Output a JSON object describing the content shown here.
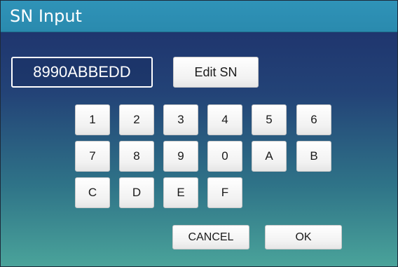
{
  "window": {
    "title": "SN Input"
  },
  "sn": {
    "value": "8990ABBEDD",
    "edit_label": "Edit SN"
  },
  "keypad": {
    "rows": [
      [
        "1",
        "2",
        "3",
        "4",
        "5",
        "6"
      ],
      [
        "7",
        "8",
        "9",
        "0",
        "A",
        "B"
      ],
      [
        "C",
        "D",
        "E",
        "F"
      ]
    ]
  },
  "actions": {
    "cancel_label": "CANCEL",
    "ok_label": "OK"
  },
  "colors": {
    "titlebar": "#2f93b8",
    "background_top": "#1d2f6a",
    "background_bottom": "#4aa39a",
    "button_face": "#f2f2f2",
    "text_light": "#ffffff"
  }
}
